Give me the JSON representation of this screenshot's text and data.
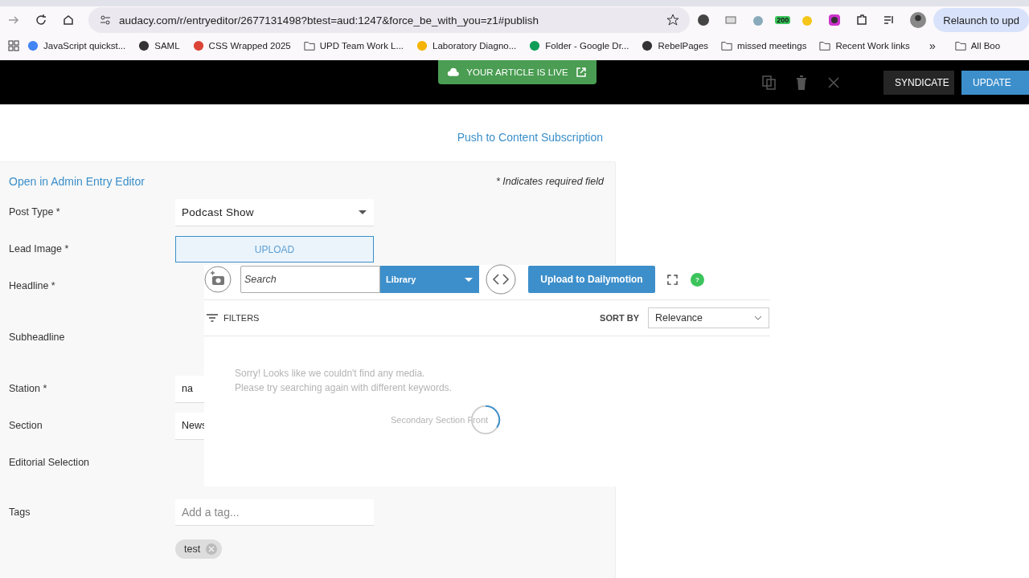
{
  "browser": {
    "url": "audacy.com/r/entryeditor/2677131498?btest=aud:1247&force_be_with_you=z1#publish",
    "extension_badge": "200",
    "relaunch": "Relaunch to upd",
    "bookmarks": [
      {
        "kind": "google",
        "label": "JavaScript quickst..."
      },
      {
        "kind": "globe",
        "label": "SAML"
      },
      {
        "kind": "chrome",
        "label": "CSS Wrapped 2025"
      },
      {
        "kind": "folder",
        "label": "UPD Team Work L..."
      },
      {
        "kind": "slides",
        "label": "Laboratory Diagno..."
      },
      {
        "kind": "drive",
        "label": "Folder - Google Dr..."
      },
      {
        "kind": "globe",
        "label": "RebelPages"
      },
      {
        "kind": "folder",
        "label": "missed meetings"
      },
      {
        "kind": "folder",
        "label": "Recent Work links"
      }
    ],
    "more": "»",
    "all_bookmarks": "All Boo"
  },
  "header": {
    "live_banner": "YOUR ARTICLE IS LIVE",
    "buttons": [
      {
        "label": "SYNDICATE",
        "kind": "dark"
      },
      {
        "label": "UPDATE",
        "kind": "primary"
      }
    ]
  },
  "push_link": "Push to Content Subscription",
  "admin_link": "Open in Admin Entry Editor",
  "required_note": "* Indicates required field",
  "fields": [
    {
      "label": "Post Type *",
      "kind": "select",
      "value": "Podcast Show"
    },
    {
      "label": "Lead Image *",
      "kind": "upload",
      "value": "UPLOAD"
    },
    {
      "label": "Headline *",
      "kind": "blank"
    },
    {
      "label": "Subheadline",
      "kind": "blank"
    },
    {
      "label": "Station *",
      "kind": "text",
      "value": "na"
    },
    {
      "label": "Section",
      "kind": "text",
      "value": "News"
    },
    {
      "label": "Editorial Selection",
      "kind": "blank"
    },
    {
      "label": "Tags",
      "kind": "tags",
      "placeholder": "Add a tag...",
      "chips": [
        "test"
      ]
    }
  ],
  "media_picker": {
    "search_placeholder": "Search",
    "source": "Library",
    "upload_button": "Upload to Dailymotion",
    "help": "?",
    "filters": "FILTERS",
    "sort_label": "SORT BY",
    "sort_value": "Relevance",
    "empty_message": [
      "Sorry! Looks like we couldn't find any media.",
      "Please try searching again with different keywords."
    ],
    "secondary_section": "Secondary Section Front"
  }
}
